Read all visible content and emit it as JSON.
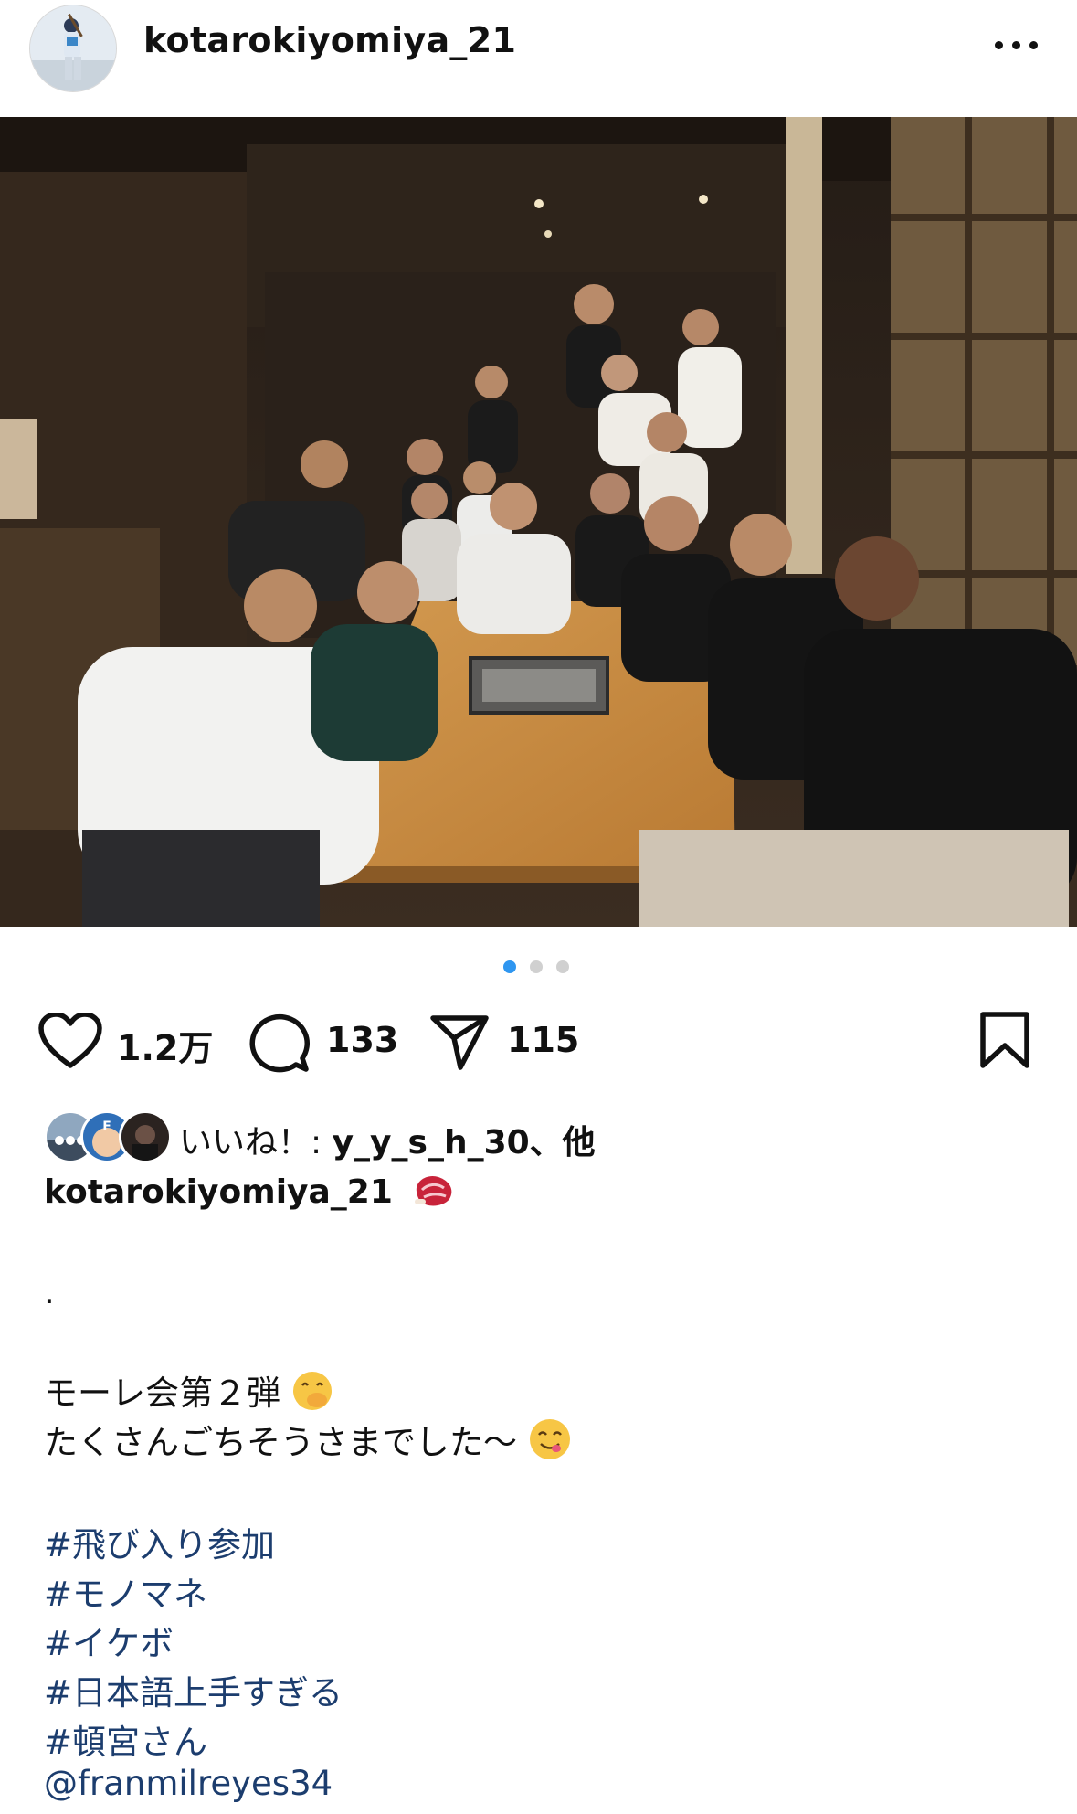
{
  "post": {
    "username": "kotarokiyomiya_21",
    "carousel": {
      "count": 3,
      "active_index": 0
    },
    "stats": {
      "likes": "1.2万",
      "comments": "133",
      "shares": "115"
    },
    "liked_by": {
      "prefix": "いいね！: ",
      "user": "y_y_s_h_30",
      "suffix": "、他"
    },
    "caption": {
      "username": "kotarokiyomiya_21",
      "dot": ".",
      "line1": "モーレ会第２弾",
      "line2": "たくさんごちそうさまでした〜",
      "hashtags": [
        "#飛び入り参加",
        "#モノマネ",
        "#イケボ",
        "#日本語上手すぎる",
        "#頓宮さん"
      ],
      "mention": "@franmilreyes34"
    }
  },
  "icons": [
    "more-icon",
    "heart-icon",
    "comment-icon",
    "share-icon",
    "bookmark-icon",
    "meat-emoji",
    "face-with-hand-emoji",
    "yum-emoji"
  ],
  "colors": {
    "hashtag": "#1c3d6e",
    "carousel_active": "#2f96f0",
    "carousel_inactive": "#d0d0d0"
  }
}
